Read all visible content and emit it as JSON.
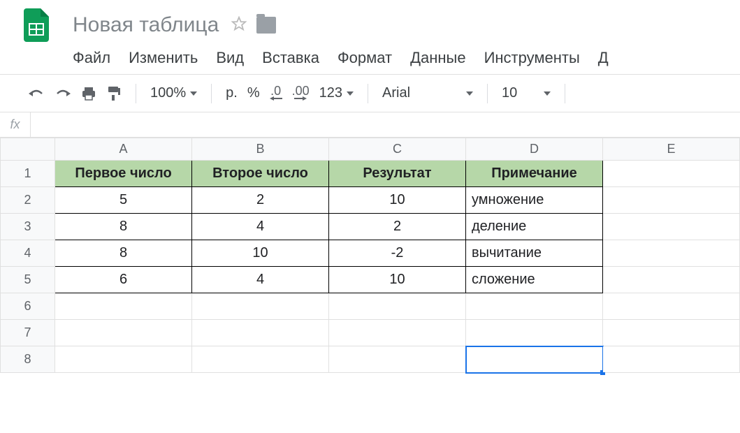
{
  "doc_title": "Новая таблица",
  "menu": {
    "file": "Файл",
    "edit": "Изменить",
    "view": "Вид",
    "insert": "Вставка",
    "format": "Формат",
    "data": "Данные",
    "tools": "Инструменты",
    "addons_partial": "Д"
  },
  "toolbar": {
    "zoom": "100%",
    "currency": "р.",
    "percent": "%",
    "dec_less": ".0",
    "dec_more": ".00",
    "more_formats": "123",
    "font": "Arial",
    "font_size": "10"
  },
  "fx_label": "fx",
  "fx_value": "",
  "columns": [
    "A",
    "B",
    "C",
    "D",
    "E"
  ],
  "rows": [
    "1",
    "2",
    "3",
    "4",
    "5",
    "6",
    "7",
    "8"
  ],
  "table": {
    "headers": {
      "A": "Первое число",
      "B": "Второе число",
      "C": "Результат",
      "D": "Примечание"
    },
    "data": [
      {
        "A": "5",
        "B": "2",
        "C": "10",
        "D": "умножение"
      },
      {
        "A": "8",
        "B": "4",
        "C": "2",
        "D": "деление"
      },
      {
        "A": "8",
        "B": "10",
        "C": "-2",
        "D": "вычитание"
      },
      {
        "A": "6",
        "B": "4",
        "C": "10",
        "D": "сложение"
      }
    ]
  },
  "selected_cell": "D8"
}
